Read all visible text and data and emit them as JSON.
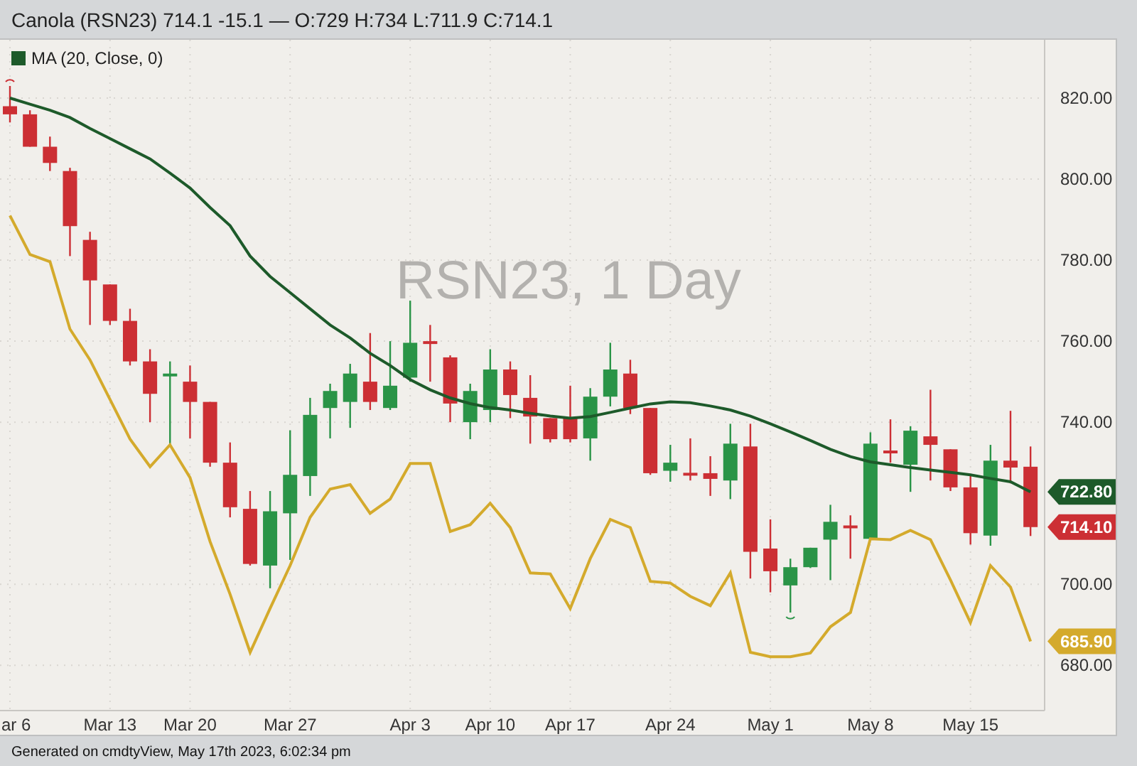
{
  "title": "Canola (RSN23) 714.1 -15.1 — O:729 H:734 L:711.9 C:714.1",
  "chart": {
    "chart_data": {
      "type": "candlestick",
      "title": "RSN23, 1 Day",
      "categories": [
        "ar 6",
        null,
        null,
        null,
        null,
        "Mar 13",
        null,
        null,
        null,
        "Mar 20",
        null,
        null,
        null,
        null,
        "Mar 27",
        null,
        null,
        null,
        null,
        null,
        "Apr 3",
        null,
        null,
        null,
        "Apr 10",
        null,
        null,
        null,
        "Apr 17",
        null,
        null,
        null,
        null,
        "Apr 24",
        null,
        null,
        null,
        null,
        "May 1",
        null,
        null,
        null,
        null,
        "May 8",
        null,
        null,
        null,
        null,
        "May 15",
        null,
        null,
        null
      ],
      "yticks": [
        {
          "value": 680,
          "label": "680.00"
        },
        {
          "value": 700,
          "label": "700.00"
        },
        {
          "value": 740,
          "label": "740.00"
        },
        {
          "value": 760,
          "label": "760.00"
        },
        {
          "value": 780,
          "label": "780.00"
        },
        {
          "value": 800,
          "label": "800.00"
        },
        {
          "value": 820,
          "label": "820.00"
        }
      ],
      "ylim": [
        668.8,
        834.4
      ],
      "grid": true,
      "ohlc": [
        [
          818,
          823,
          814,
          816
        ],
        [
          816,
          817,
          808,
          808
        ],
        [
          808,
          810.5,
          802,
          804
        ],
        [
          802,
          802.8,
          781,
          788.4
        ],
        [
          785,
          787,
          764,
          775
        ],
        [
          774,
          774,
          764,
          765
        ],
        [
          765,
          768,
          754,
          755
        ],
        [
          755,
          758,
          740,
          747
        ],
        [
          751.5,
          755,
          734.5,
          752
        ],
        [
          750,
          754,
          736,
          745
        ],
        [
          745,
          745,
          729,
          730
        ],
        [
          730,
          735,
          716.5,
          719
        ],
        [
          718.6,
          723,
          704.6,
          705
        ],
        [
          704.6,
          723,
          699,
          718
        ],
        [
          717.5,
          738,
          706,
          727
        ],
        [
          726.7,
          746,
          721.8,
          741.8
        ],
        [
          743.5,
          749.5,
          736,
          747.7
        ],
        [
          745,
          754.4,
          738.6,
          752
        ],
        [
          750,
          762,
          743,
          745
        ],
        [
          743.5,
          760,
          743,
          749
        ],
        [
          751,
          770,
          750,
          759.6
        ],
        [
          760,
          764,
          750,
          759.5
        ],
        [
          756,
          756.5,
          740,
          744.6
        ],
        [
          740,
          749.5,
          735.8,
          747.7
        ],
        [
          743,
          758,
          740,
          753
        ],
        [
          753,
          755,
          741,
          746.7
        ],
        [
          746,
          751.6,
          734.7,
          741.4
        ],
        [
          741,
          741,
          735,
          735.8
        ],
        [
          741,
          749,
          735,
          735.8
        ],
        [
          736,
          748.4,
          730.5,
          746.3
        ],
        [
          746.3,
          759.6,
          743.9,
          753
        ],
        [
          752,
          755.4,
          742,
          743.5
        ],
        [
          743.5,
          743.5,
          727,
          727.4
        ],
        [
          728,
          734.4,
          725.3,
          730
        ],
        [
          727.5,
          736,
          725.6,
          727.2
        ],
        [
          727.4,
          731.6,
          721.8,
          726
        ],
        [
          725.6,
          739.6,
          721,
          734.7
        ],
        [
          734,
          739.6,
          701.4,
          708
        ],
        [
          708.8,
          716,
          698,
          703.2
        ],
        [
          699.7,
          706.3,
          693,
          704.2
        ],
        [
          704.2,
          709,
          704,
          709
        ],
        [
          711,
          719.6,
          701,
          715.4
        ],
        [
          714.5,
          717,
          706.3,
          714
        ],
        [
          711.2,
          737.5,
          711,
          734.7
        ],
        [
          733,
          740.7,
          730,
          732.6
        ],
        [
          729.5,
          739,
          722.8,
          737.9
        ],
        [
          736.5,
          748,
          725.6,
          734.4
        ],
        [
          733.3,
          733.3,
          723,
          723.9
        ],
        [
          723.9,
          727,
          709.8,
          712.6
        ],
        [
          712,
          734.4,
          709.5,
          730.5
        ],
        [
          730.5,
          742.8,
          724.9,
          728.8
        ],
        [
          729,
          734,
          711.9,
          714.1
        ]
      ],
      "series": [
        {
          "name": "MA (20, Close, 0)",
          "type": "line",
          "color": "#1d5a2a",
          "values": [
            820,
            818.5,
            817,
            815.2,
            812.5,
            810,
            807.5,
            805,
            801.5,
            797.8,
            793,
            788.5,
            781,
            776,
            772,
            768,
            764,
            760.8,
            757,
            754,
            750.5,
            748,
            746,
            744.6,
            743.6,
            743,
            742.2,
            741.5,
            741,
            741.4,
            742.4,
            743.5,
            744.5,
            745,
            744.8,
            744,
            743,
            741.5,
            739.6,
            737.6,
            735.5,
            733.3,
            731.5,
            730.2,
            729.5,
            728.8,
            728.2,
            727.6,
            727,
            726.1,
            725.3,
            722.8
          ]
        },
        {
          "type": "line",
          "color": "#d4aa2c",
          "values": [
            791,
            781.4,
            779.6,
            763,
            755.4,
            745.6,
            735.8,
            729,
            734.4,
            726.3,
            710.5,
            697.5,
            683.2,
            694,
            704.6,
            716.5,
            723.5,
            724.6,
            717.5,
            721,
            729.8,
            729.8,
            713,
            714.7,
            720,
            714,
            702.8,
            702.5,
            694,
            706.3,
            716,
            714,
            700.7,
            700.3,
            697,
            694.7,
            702.8,
            683.2,
            682.1,
            682.1,
            683,
            689.5,
            693,
            711.2,
            711,
            713.3,
            711,
            701,
            690.5,
            704.6,
            699.3,
            685.9
          ]
        }
      ]
    },
    "price_tags": [
      {
        "text": "722.80",
        "color": "#1d5a2a",
        "kind": "average"
      },
      {
        "text": "714.10",
        "color": "#cc2f34",
        "kind": "close"
      },
      {
        "text": "685.90",
        "color": "#d4aa2c",
        "kind": "line"
      }
    ]
  },
  "footer": "Generated on cmdtyView, May 17th 2023, 6:02:34 pm"
}
